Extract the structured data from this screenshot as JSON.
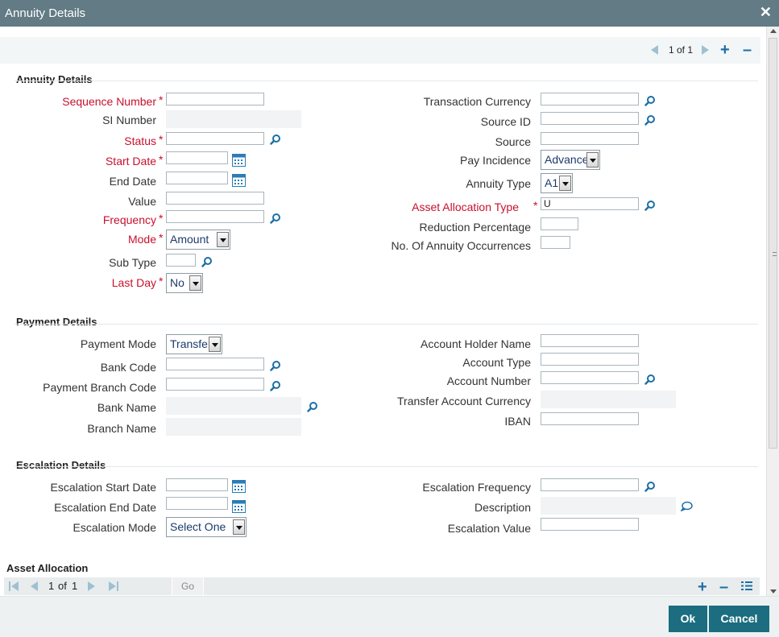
{
  "window": {
    "title": "Annuity Details"
  },
  "pager": {
    "text": "1 of 1"
  },
  "annuity": {
    "title": "Annuity Details",
    "sequence_number": "Sequence Number",
    "si_number": "SI Number",
    "status": "Status",
    "start_date": "Start Date",
    "end_date": "End Date",
    "value": "Value",
    "frequency": "Frequency",
    "mode": "Mode",
    "mode_value": "Amount",
    "sub_type": "Sub Type",
    "last_day": "Last Day",
    "last_day_value": "No",
    "transaction_currency": "Transaction Currency",
    "source_id": "Source ID",
    "source": "Source",
    "pay_incidence": "Pay Incidence",
    "pay_incidence_value": "Advance",
    "annuity_type": "Annuity Type",
    "annuity_type_value": "A1",
    "asset_allocation_type": "Asset Allocation Type",
    "asset_allocation_type_value": "U",
    "reduction_percentage": "Reduction Percentage",
    "no_of_occurrences": "No. Of Annuity Occurrences"
  },
  "payment": {
    "title": "Payment Details",
    "payment_mode": "Payment Mode",
    "payment_mode_value": "Transfer",
    "bank_code": "Bank Code",
    "payment_branch_code": "Payment Branch Code",
    "bank_name": "Bank Name",
    "branch_name": "Branch Name",
    "account_holder_name": "Account Holder Name",
    "account_type": "Account Type",
    "account_number": "Account Number",
    "transfer_account_currency": "Transfer Account Currency",
    "iban": "IBAN"
  },
  "escalation": {
    "title": "Escalation Details",
    "start_date": "Escalation Start Date",
    "end_date": "Escalation End Date",
    "mode": "Escalation Mode",
    "mode_value": "Select One",
    "frequency": "Escalation Frequency",
    "description": "Description",
    "value": "Escalation Value"
  },
  "asset_allocation": {
    "title": "Asset Allocation",
    "page": "1",
    "of": "of",
    "total": "1",
    "go": "Go"
  },
  "footer": {
    "ok": "Ok",
    "cancel": "Cancel"
  },
  "required_marker": "*",
  "icons": {
    "close": "close-icon",
    "search": "search-icon",
    "calendar": "calendar-icon",
    "description": "chat-bubble-icon",
    "add": "plus-icon",
    "remove": "minus-icon",
    "columns": "list-icon"
  },
  "colors": {
    "titlebar": "#627b85",
    "required": "#c8102e",
    "button": "#1b6d7f",
    "icon": "#1c6fa6"
  }
}
